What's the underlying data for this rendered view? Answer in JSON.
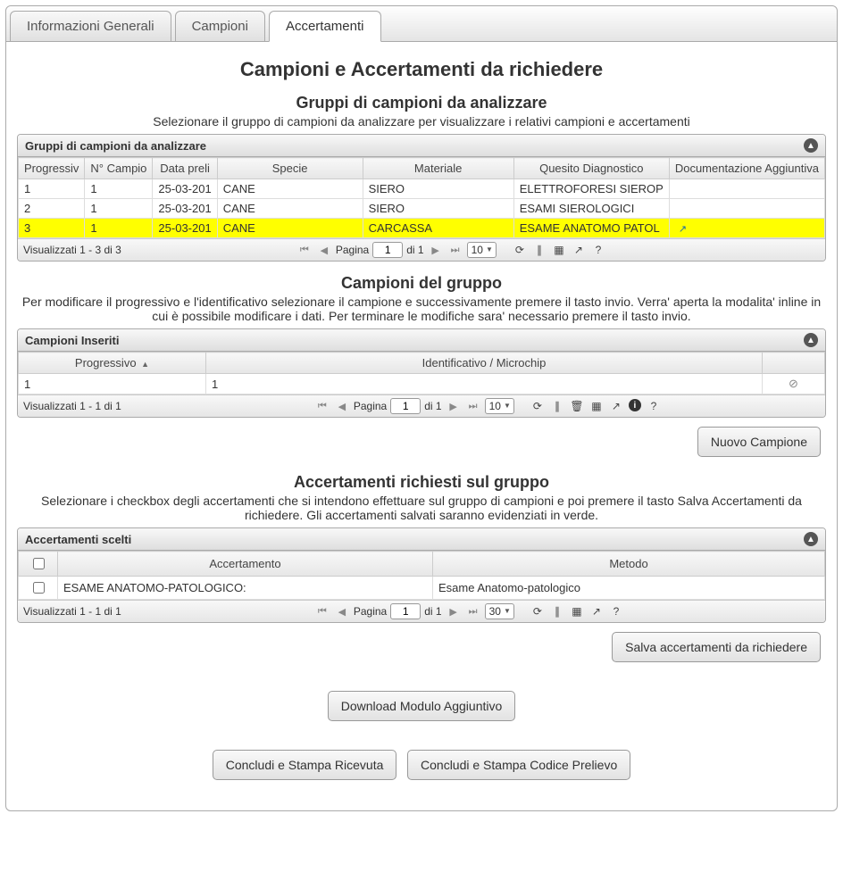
{
  "tabs": {
    "info": "Informazioni Generali",
    "campioni": "Campioni",
    "accertamenti": "Accertamenti"
  },
  "page_title": "Campioni e Accertamenti da richiedere",
  "section1": {
    "heading": "Gruppi di campioni da analizzare",
    "sub": "Selezionare il gruppo di campioni da analizzare per visualizzare i relativi campioni e accertamenti",
    "panel_title": "Gruppi di campioni da analizzare",
    "cols": {
      "prog": "Progressiv",
      "ncamp": "N° Campio",
      "data": "Data preli",
      "specie": "Specie",
      "materiale": "Materiale",
      "quesito": "Quesito Diagnostico",
      "doc": "Documentazione Aggiuntiva"
    },
    "rows": [
      {
        "prog": "1",
        "ncamp": "1",
        "data": "25-03-201",
        "specie": "CANE",
        "materiale": "SIERO",
        "quesito": "ELETTROFORESI SIEROP",
        "doc": "",
        "selected": false
      },
      {
        "prog": "2",
        "ncamp": "1",
        "data": "25-03-201",
        "specie": "CANE",
        "materiale": "SIERO",
        "quesito": "ESAMI SIEROLOGICI",
        "doc": "",
        "selected": false
      },
      {
        "prog": "3",
        "ncamp": "1",
        "data": "25-03-201",
        "specie": "CANE",
        "materiale": "CARCASSA",
        "quesito": "ESAME ANATOMO PATOL",
        "doc": "ext",
        "selected": true
      }
    ],
    "footer": {
      "viewing": "Visualizzati 1 - 3 di 3",
      "page_label_pre": "Pagina",
      "page": "1",
      "page_label_post": "di 1",
      "page_size": "10"
    }
  },
  "section2": {
    "heading": "Campioni del gruppo",
    "sub": "Per modificare il progressivo e l'identificativo selezionare il campione e successivamente premere il tasto invio. Verra' aperta la modalita' inline in cui è possibile modificare i dati. Per terminare le modifiche sara' necessario premere il tasto invio.",
    "panel_title": "Campioni Inseriti",
    "cols": {
      "prog": "Progressivo",
      "ident": "Identificativo / Microchip"
    },
    "rows": [
      {
        "prog": "1",
        "ident": "1"
      }
    ],
    "footer": {
      "viewing": "Visualizzati 1 - 1 di 1",
      "page_label_pre": "Pagina",
      "page": "1",
      "page_label_post": "di 1",
      "page_size": "10"
    },
    "new_btn": "Nuovo Campione"
  },
  "section3": {
    "heading": "Accertamenti richiesti sul gruppo",
    "sub": "Selezionare i checkbox degli accertamenti che si intendono effettuare sul gruppo di campioni e poi premere il tasto Salva Accertamenti da richiedere. Gli accertamenti salvati saranno evidenziati in verde.",
    "panel_title": "Accertamenti scelti",
    "cols": {
      "acc": "Accertamento",
      "met": "Metodo"
    },
    "rows": [
      {
        "acc": "ESAME ANATOMO-PATOLOGICO:",
        "met": "Esame Anatomo-patologico"
      }
    ],
    "footer": {
      "viewing": "Visualizzati 1 - 1 di 1",
      "page_label_pre": "Pagina",
      "page": "1",
      "page_label_post": "di 1",
      "page_size": "30"
    },
    "save_btn": "Salva accertamenti da richiedere"
  },
  "bottom": {
    "download": "Download Modulo Aggiuntivo",
    "concludi_ricevuta": "Concludi e Stampa Ricevuta",
    "concludi_codice": "Concludi e Stampa Codice Prelievo"
  }
}
